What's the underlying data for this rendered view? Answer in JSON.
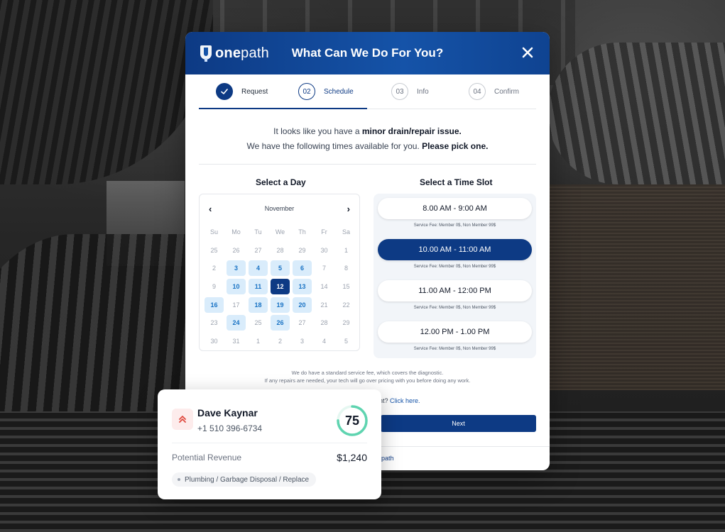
{
  "brand": {
    "name_bold": "one",
    "name_thin": "path"
  },
  "modal": {
    "title": "What Can We Do For You?",
    "close_icon": "close-icon"
  },
  "steps": [
    {
      "number": "",
      "label": "Request",
      "state": "done"
    },
    {
      "number": "02",
      "label": "Schedule",
      "state": "active"
    },
    {
      "number": "03",
      "label": "Info",
      "state": "todo"
    },
    {
      "number": "04",
      "label": "Confirm",
      "state": "todo"
    }
  ],
  "intro": {
    "line1_prefix": "It looks like you have a ",
    "line1_bold": "minor drain/repair issue.",
    "line2_prefix": "We have the following times available for you. ",
    "line2_bold": "Please pick one."
  },
  "day_picker": {
    "title": "Select a Day",
    "month": "November",
    "prev_icon": "chevron-left-icon",
    "next_icon": "chevron-right-icon",
    "weekdays": [
      "Su",
      "Mo",
      "Tu",
      "We",
      "Th",
      "Fr",
      "Sa"
    ],
    "weeks": [
      [
        "25",
        "26",
        "27",
        "28",
        "29",
        "30",
        "1"
      ],
      [
        "2",
        "3",
        "4",
        "5",
        "6",
        "7",
        "8"
      ],
      [
        "9",
        "10",
        "11",
        "12",
        "13",
        "14",
        "15"
      ],
      [
        "16",
        "17",
        "18",
        "19",
        "20",
        "21",
        "22"
      ],
      [
        "23",
        "24",
        "25",
        "26",
        "27",
        "28",
        "29"
      ],
      [
        "30",
        "31",
        "1",
        "2",
        "3",
        "4",
        "5"
      ]
    ],
    "available_days": [
      "3",
      "4",
      "5",
      "6",
      "10",
      "11",
      "13",
      "16",
      "18",
      "19",
      "20",
      "24",
      "26"
    ],
    "selected_day": "12"
  },
  "time_picker": {
    "title": "Select a Time Slot",
    "slots": [
      {
        "label": "8.00 AM - 9:00 AM",
        "fee": "Service Fee: Member 0$, Non Member 99$",
        "selected": false
      },
      {
        "label": "10.00 AM - 11:00 AM",
        "fee": "Service Fee: Member 0$, Non Member 99$",
        "selected": true
      },
      {
        "label": "11.00 AM - 12:00 PM",
        "fee": "Service Fee: Member 0$, Non Member 99$",
        "selected": false
      },
      {
        "label": "12.00 PM - 1.00 PM",
        "fee": "Service Fee: Member 0$, Non Member 99$",
        "selected": false
      }
    ]
  },
  "note": {
    "line1": "We do have a standard service fee, which covers the diagnostic.",
    "line2": "If any repairs are needed, your tech will go over pricing with you before doing any work."
  },
  "link_line": {
    "prefix": "nt? ",
    "link": "Click here."
  },
  "next_button": "Next",
  "footer_brand": "epath",
  "lead": {
    "name": "Dave Kaynar",
    "phone": "+1 510 396-6734",
    "score": "75",
    "score_fraction": 0.75,
    "priority_icon": "double-chevron-up-icon",
    "revenue_label": "Potential Revenue",
    "revenue_value": "$1,240",
    "tag": "Plumbing / Garbage Disposal / Replace"
  },
  "colors": {
    "brand_navy": "#0d3a84",
    "header_blue": "#1553a8",
    "available_day_bg": "#d9ecfb",
    "available_day_text": "#1a73c4",
    "score_ring": "#5fd4b0",
    "priority_red": "#e04a3f"
  }
}
